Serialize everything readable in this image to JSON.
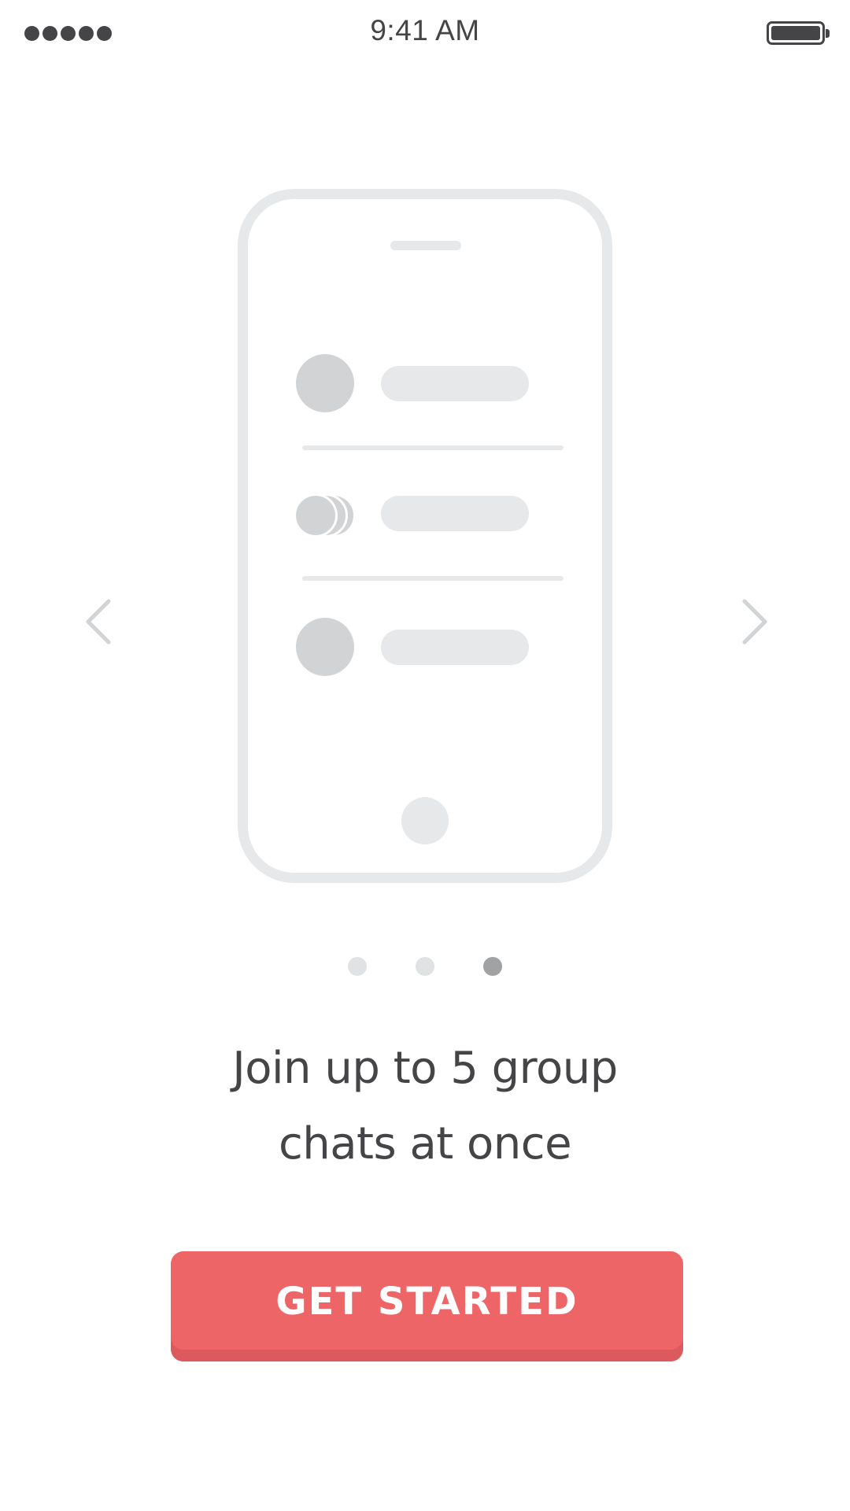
{
  "status_bar": {
    "signal_icon": "signal-dots-icon",
    "time": "9:41 AM",
    "battery_icon": "battery-full-icon"
  },
  "illustration": {
    "icon": "phone-chat-list-illustration",
    "rows": 3
  },
  "carousel": {
    "prev_icon": "chevron-left-icon",
    "next_icon": "chevron-right-icon",
    "page_count": 3,
    "active_page": 3
  },
  "headline": {
    "line1": "Join up to 5 group",
    "line2": "chats at once"
  },
  "cta": {
    "label": "GET STARTED"
  },
  "colors": {
    "accent": "#ee6568",
    "accent_shadow": "#dc5a5d",
    "text": "#454547",
    "placeholder_light": "#e7e8e9",
    "placeholder_dark": "#d2d3d5",
    "pager_inactive": "#e1e2e3",
    "pager_active": "#a1a2a3"
  }
}
